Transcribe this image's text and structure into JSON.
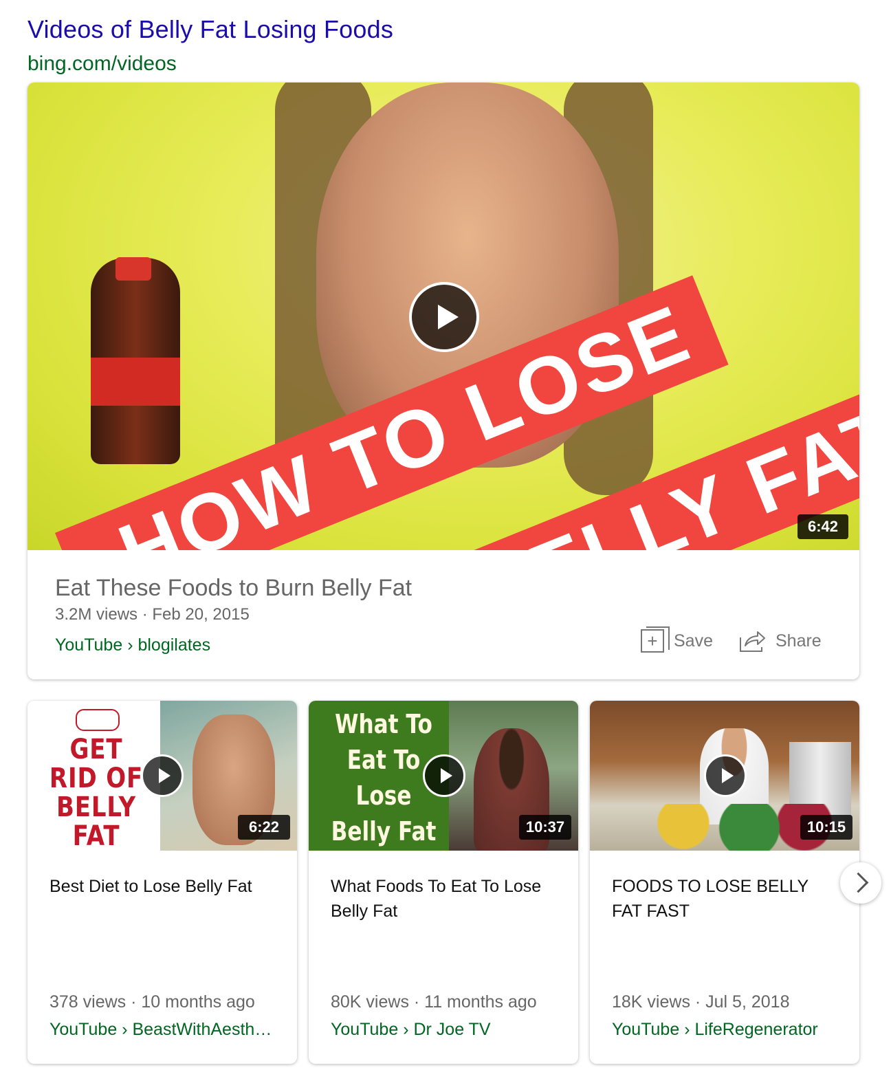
{
  "header": {
    "title": "Videos of Belly Fat Losing Foods",
    "source": "bing.com/videos"
  },
  "featured": {
    "thumbnail_text": [
      "HOW TO LOSE",
      "BELLY FAT"
    ],
    "duration": "6:42",
    "title": "Eat These Foods to Burn Belly Fat",
    "meta": "3.2M views · Feb 20, 2015",
    "source": "YouTube › blogilates",
    "save_label": "Save",
    "share_label": "Share"
  },
  "videos": [
    {
      "thumbnail_text": "GET RID OF BELLY FAT",
      "duration": "6:22",
      "title": "Best Diet to Lose Belly Fat",
      "meta": "378 views · 10 months ago",
      "source": "YouTube › BeastWithAesth…"
    },
    {
      "thumbnail_text": "What To Eat To Lose Belly Fat {Food Plate}",
      "duration": "10:37",
      "title": "What Foods To Eat To Lose Belly Fat",
      "meta": "80K views · 11 months ago",
      "source": "YouTube › Dr Joe TV"
    },
    {
      "duration": "10:15",
      "title": "FOODS TO LOSE BELLY FAT FAST",
      "meta": "18K views · Jul 5, 2018",
      "source": "YouTube › LifeRegenerator"
    }
  ],
  "icons": {
    "play": "play-icon",
    "save": "save-icon",
    "share": "share-icon",
    "next": "chevron-right-icon"
  },
  "colors": {
    "link": "#1a0dab",
    "url": "#006621",
    "banner": "#f0463f"
  }
}
